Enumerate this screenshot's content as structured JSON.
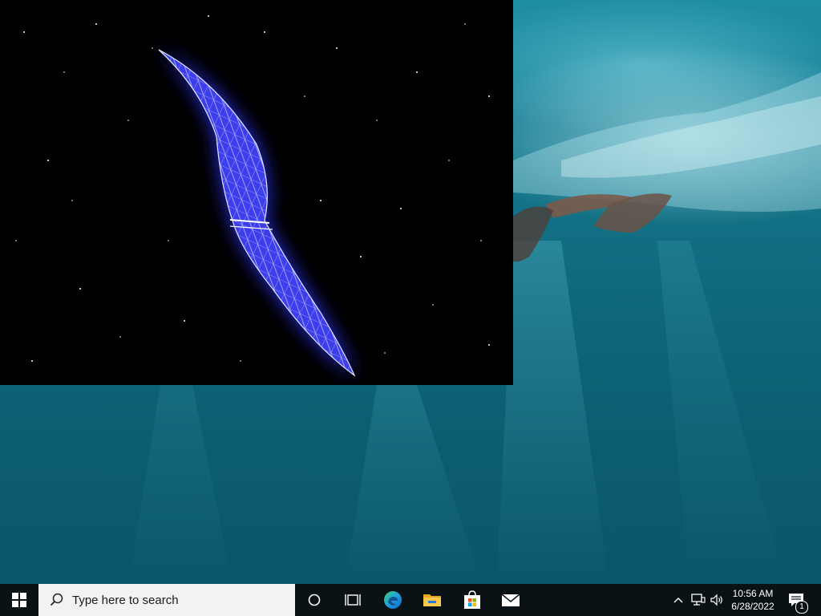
{
  "desktop": {
    "wallpaper": "underwater-swimmer",
    "screensaver_window": {
      "content": "wireframe-crescent-starfield",
      "accent": "#3a3cff"
    }
  },
  "taskbar": {
    "start_icon": "windows-logo-icon",
    "search": {
      "placeholder": "Type here to search",
      "icon": "search-icon"
    },
    "pinned": [
      {
        "name": "cortana",
        "icon": "circle-icon"
      },
      {
        "name": "task-view",
        "icon": "task-view-icon"
      },
      {
        "name": "microsoft-edge",
        "icon": "edge-icon"
      },
      {
        "name": "file-explorer",
        "icon": "folder-icon"
      },
      {
        "name": "microsoft-store",
        "icon": "store-bag-icon"
      },
      {
        "name": "mail",
        "icon": "envelope-icon"
      }
    ],
    "tray": {
      "time": "10:56 AM",
      "date": "6/28/2022",
      "notification_count": "1"
    },
    "colors": {
      "background": "#0a1215",
      "search_bg": "#f2f2f2",
      "edge_accent": "#1fa0e0"
    }
  }
}
